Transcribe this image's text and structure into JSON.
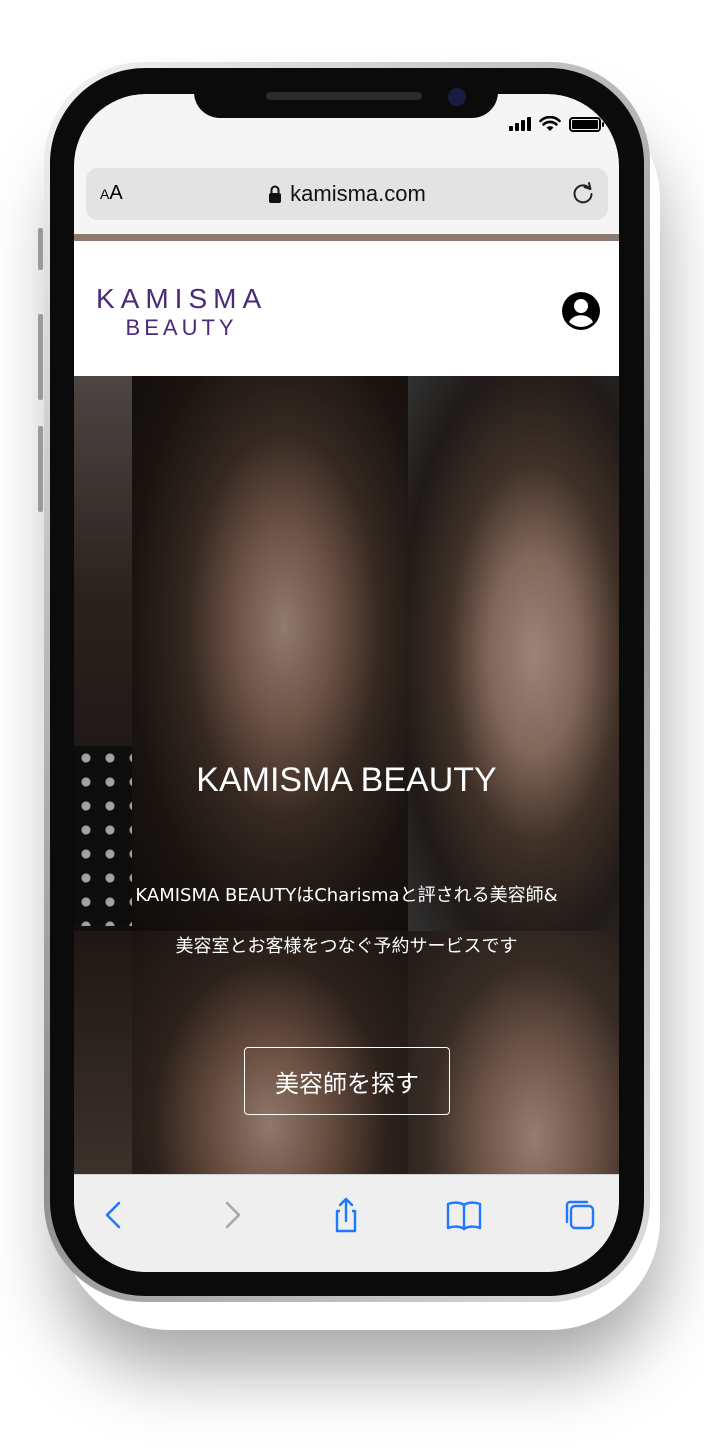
{
  "browser": {
    "text_size_small": "A",
    "text_size_large": "A",
    "url": "kamisma.com"
  },
  "site": {
    "logo_main": "KAMISMA",
    "logo_sub": "BEAUTY"
  },
  "hero": {
    "title": "KAMISMA BEAUTY",
    "desc_line1": "KAMISMA BEAUTYはCharismaと評される美容師&",
    "desc_line2": "美容室とお客様をつなぐ予約サービスです",
    "cta": "美容師を探す"
  },
  "icons": {
    "status": [
      "signal-icon",
      "wifi-icon",
      "battery-icon"
    ],
    "url_bar": [
      "lock-icon",
      "reload-icon"
    ],
    "header": [
      "account-icon"
    ],
    "toolbar": [
      "back-icon",
      "forward-icon",
      "share-icon",
      "bookmarks-icon",
      "tabs-icon"
    ]
  },
  "colors": {
    "brand": "#4a2a7a",
    "accent_line": "#8a7a6f",
    "toolbar_icons": "#1f78ff",
    "toolbar_icons_disabled": "#a7a7a7"
  }
}
